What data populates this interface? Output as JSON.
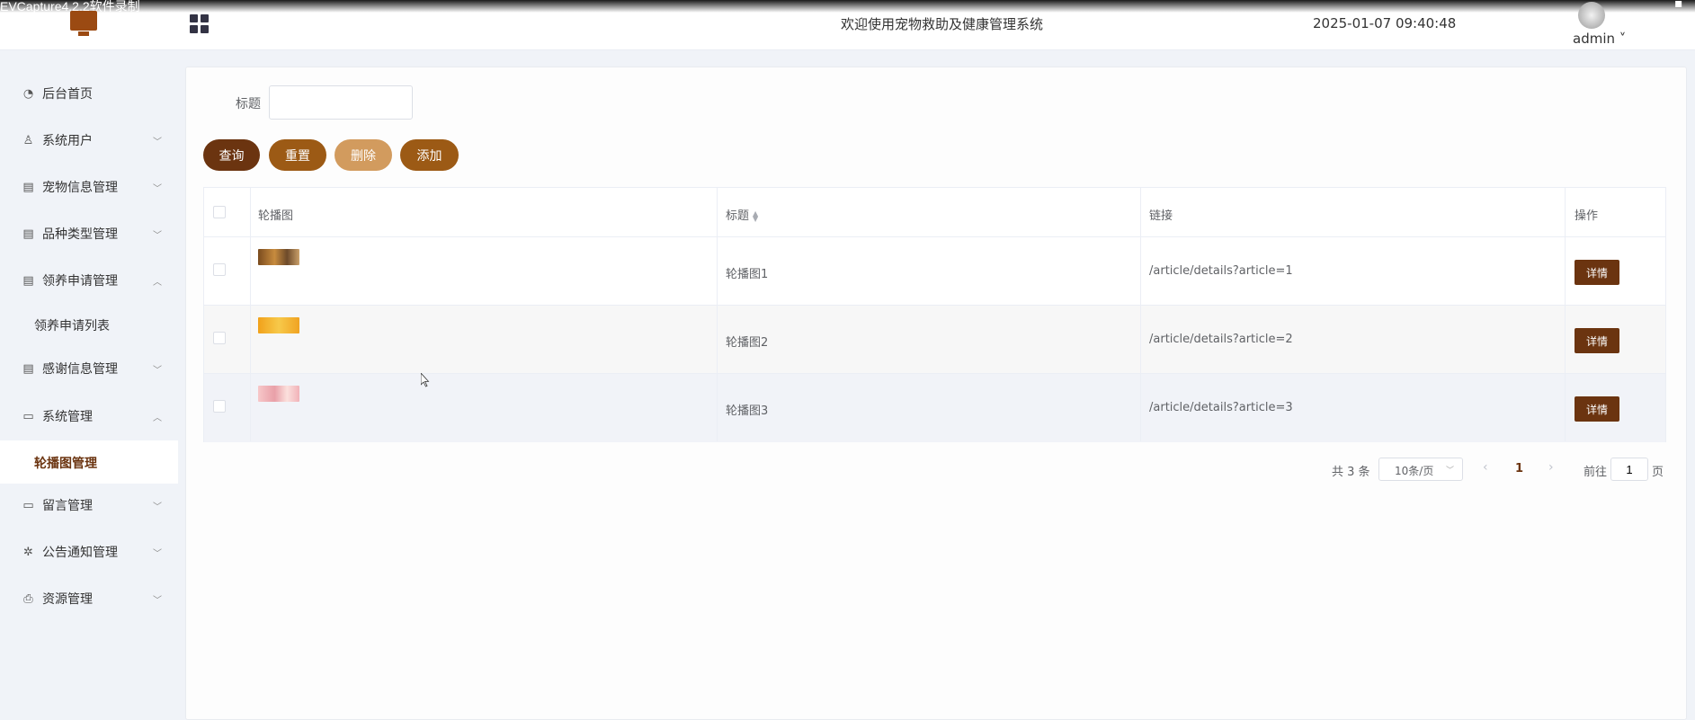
{
  "window": {
    "overlay_title": "EVCapture4.2.2软件录制"
  },
  "header": {
    "system_title": "欢迎使用宠物救助及健康管理系统",
    "datetime": "2025-01-07 09:40:48",
    "user": "admin ˅"
  },
  "sidebar": {
    "items": [
      {
        "label": "后台首页",
        "icon": "pie-chart-icon"
      },
      {
        "label": "系统用户",
        "icon": "user-icon"
      },
      {
        "label": "宠物信息管理",
        "icon": "card-icon"
      },
      {
        "label": "品种类型管理",
        "icon": "card-icon"
      },
      {
        "label": "领养申请管理",
        "icon": "card-icon"
      },
      {
        "label": "感谢信息管理",
        "icon": "card-icon"
      },
      {
        "label": "系统管理",
        "icon": "folder-icon"
      },
      {
        "label": "留言管理",
        "icon": "folder-icon"
      },
      {
        "label": "公告通知管理",
        "icon": "loading-icon"
      },
      {
        "label": "资源管理",
        "icon": "printer-icon"
      }
    ],
    "sub_items": {
      "adoption_list": "领养申请列表",
      "carousel_manage": "轮播图管理"
    }
  },
  "search": {
    "label": "标题",
    "value": ""
  },
  "toolbar": {
    "query": "查询",
    "reset": "重置",
    "delete": "删除",
    "add": "添加"
  },
  "table": {
    "headers": {
      "image": "轮播图",
      "title": "标题",
      "link": "链接",
      "action": "操作"
    },
    "rows": [
      {
        "title": "轮播图1",
        "link": "/article/details?article=1",
        "action": "详情"
      },
      {
        "title": "轮播图2",
        "link": "/article/details?article=2",
        "action": "详情"
      },
      {
        "title": "轮播图3",
        "link": "/article/details?article=3",
        "action": "详情"
      }
    ]
  },
  "pagination": {
    "total": "共 3 条",
    "page_size": "10条/页",
    "current": "1",
    "goto_label": "前往",
    "goto_value": "1",
    "page_suffix": "页"
  },
  "colors": {
    "primary": "#6b3410",
    "secondary": "#9c5a15",
    "disabled": "#d29b5e"
  }
}
